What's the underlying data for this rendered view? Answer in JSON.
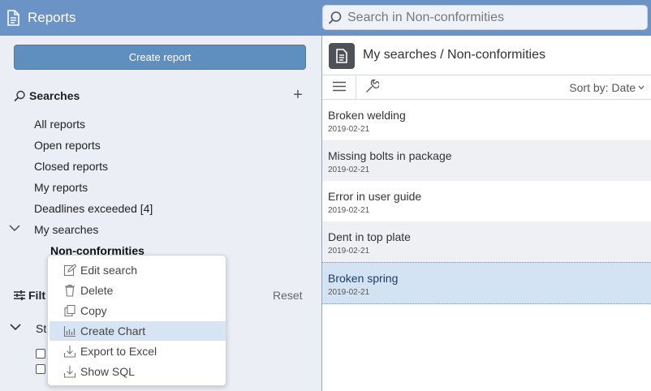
{
  "header": {
    "app_title": "Reports",
    "search_placeholder": "Search in Non-conformities"
  },
  "left": {
    "create_button": "Create report",
    "searches_title": "Searches",
    "add_symbol": "+",
    "nav": [
      {
        "label": "All reports"
      },
      {
        "label": "Open reports"
      },
      {
        "label": "Closed reports"
      },
      {
        "label": "My reports"
      },
      {
        "label": "Deadlines exceeded [4]"
      },
      {
        "label": "My searches"
      }
    ],
    "sub_item": "Non-conformities",
    "filter_title_visible": "Filt",
    "reset_label": "Reset",
    "status_label_visible": "St"
  },
  "context_menu": {
    "items": [
      {
        "label": "Edit search",
        "icon": "edit-icon"
      },
      {
        "label": "Delete",
        "icon": "trash-icon"
      },
      {
        "label": "Copy",
        "icon": "copy-icon"
      },
      {
        "label": "Create Chart",
        "icon": "chart-icon",
        "highlighted": true
      },
      {
        "label": "Export to Excel",
        "icon": "export-icon"
      },
      {
        "label": "Show SQL",
        "icon": "export-icon"
      }
    ]
  },
  "right": {
    "title": "My searches / Non-conformities",
    "sort_label": "Sort by: Date",
    "rows": [
      {
        "title": "Broken welding",
        "date": "2019-02-21"
      },
      {
        "title": "Missing bolts in package",
        "date": "2019-02-21"
      },
      {
        "title": "Error in user guide",
        "date": "2019-02-21"
      },
      {
        "title": "Dent in top plate",
        "date": "2019-02-21"
      },
      {
        "title": "Broken spring",
        "date": "2019-02-21",
        "selected": true
      }
    ]
  },
  "colors": {
    "header_bg": "#6b93c6",
    "button_bg": "#5f8fbf",
    "panel_bg": "#ebeef5",
    "selection_bg": "#d3e3f4"
  }
}
